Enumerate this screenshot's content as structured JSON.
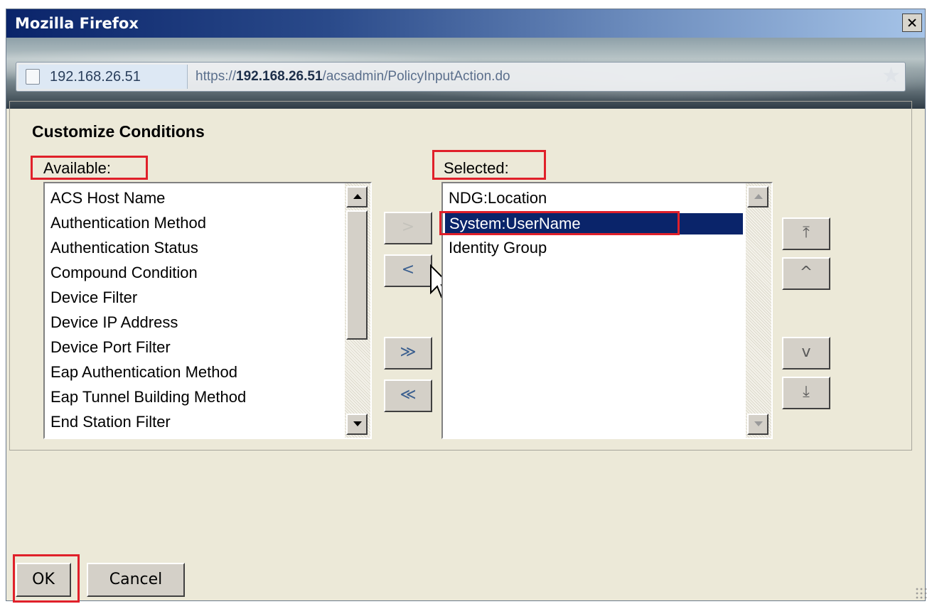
{
  "window": {
    "title": "Mozilla Firefox"
  },
  "address_bar": {
    "site_identity": "192.168.26.51",
    "url_prefix": "https://",
    "url_host": "192.168.26.51",
    "url_path": "/acsadmin/PolicyInputAction.do"
  },
  "dialog": {
    "title": "Customize Conditions",
    "available_label": "Available:",
    "selected_label": "Selected:",
    "available_items": [
      "ACS Host Name",
      "Authentication Method",
      "Authentication Status",
      "Compound Condition",
      "Device Filter",
      "Device IP Address",
      "Device Port Filter",
      "Eap Authentication Method",
      "Eap Tunnel Building Method",
      "End Station Filter"
    ],
    "selected_items": [
      "NDG:Location",
      "System:UserName",
      "Identity Group"
    ],
    "selected_index": 1,
    "transfer_buttons": {
      "add": ">",
      "remove": "<",
      "add_all": "≫",
      "remove_all": "≪"
    },
    "order_buttons": {
      "top": "⤒",
      "up": "^",
      "down": "v",
      "bottom": "⤓"
    }
  },
  "footer": {
    "ok_label": "OK",
    "cancel_label": "Cancel"
  },
  "annotations": {
    "highlight_color": "#e0202a"
  },
  "colors": {
    "selection_bg": "#0a246a",
    "window_bg": "#ece9d8"
  }
}
